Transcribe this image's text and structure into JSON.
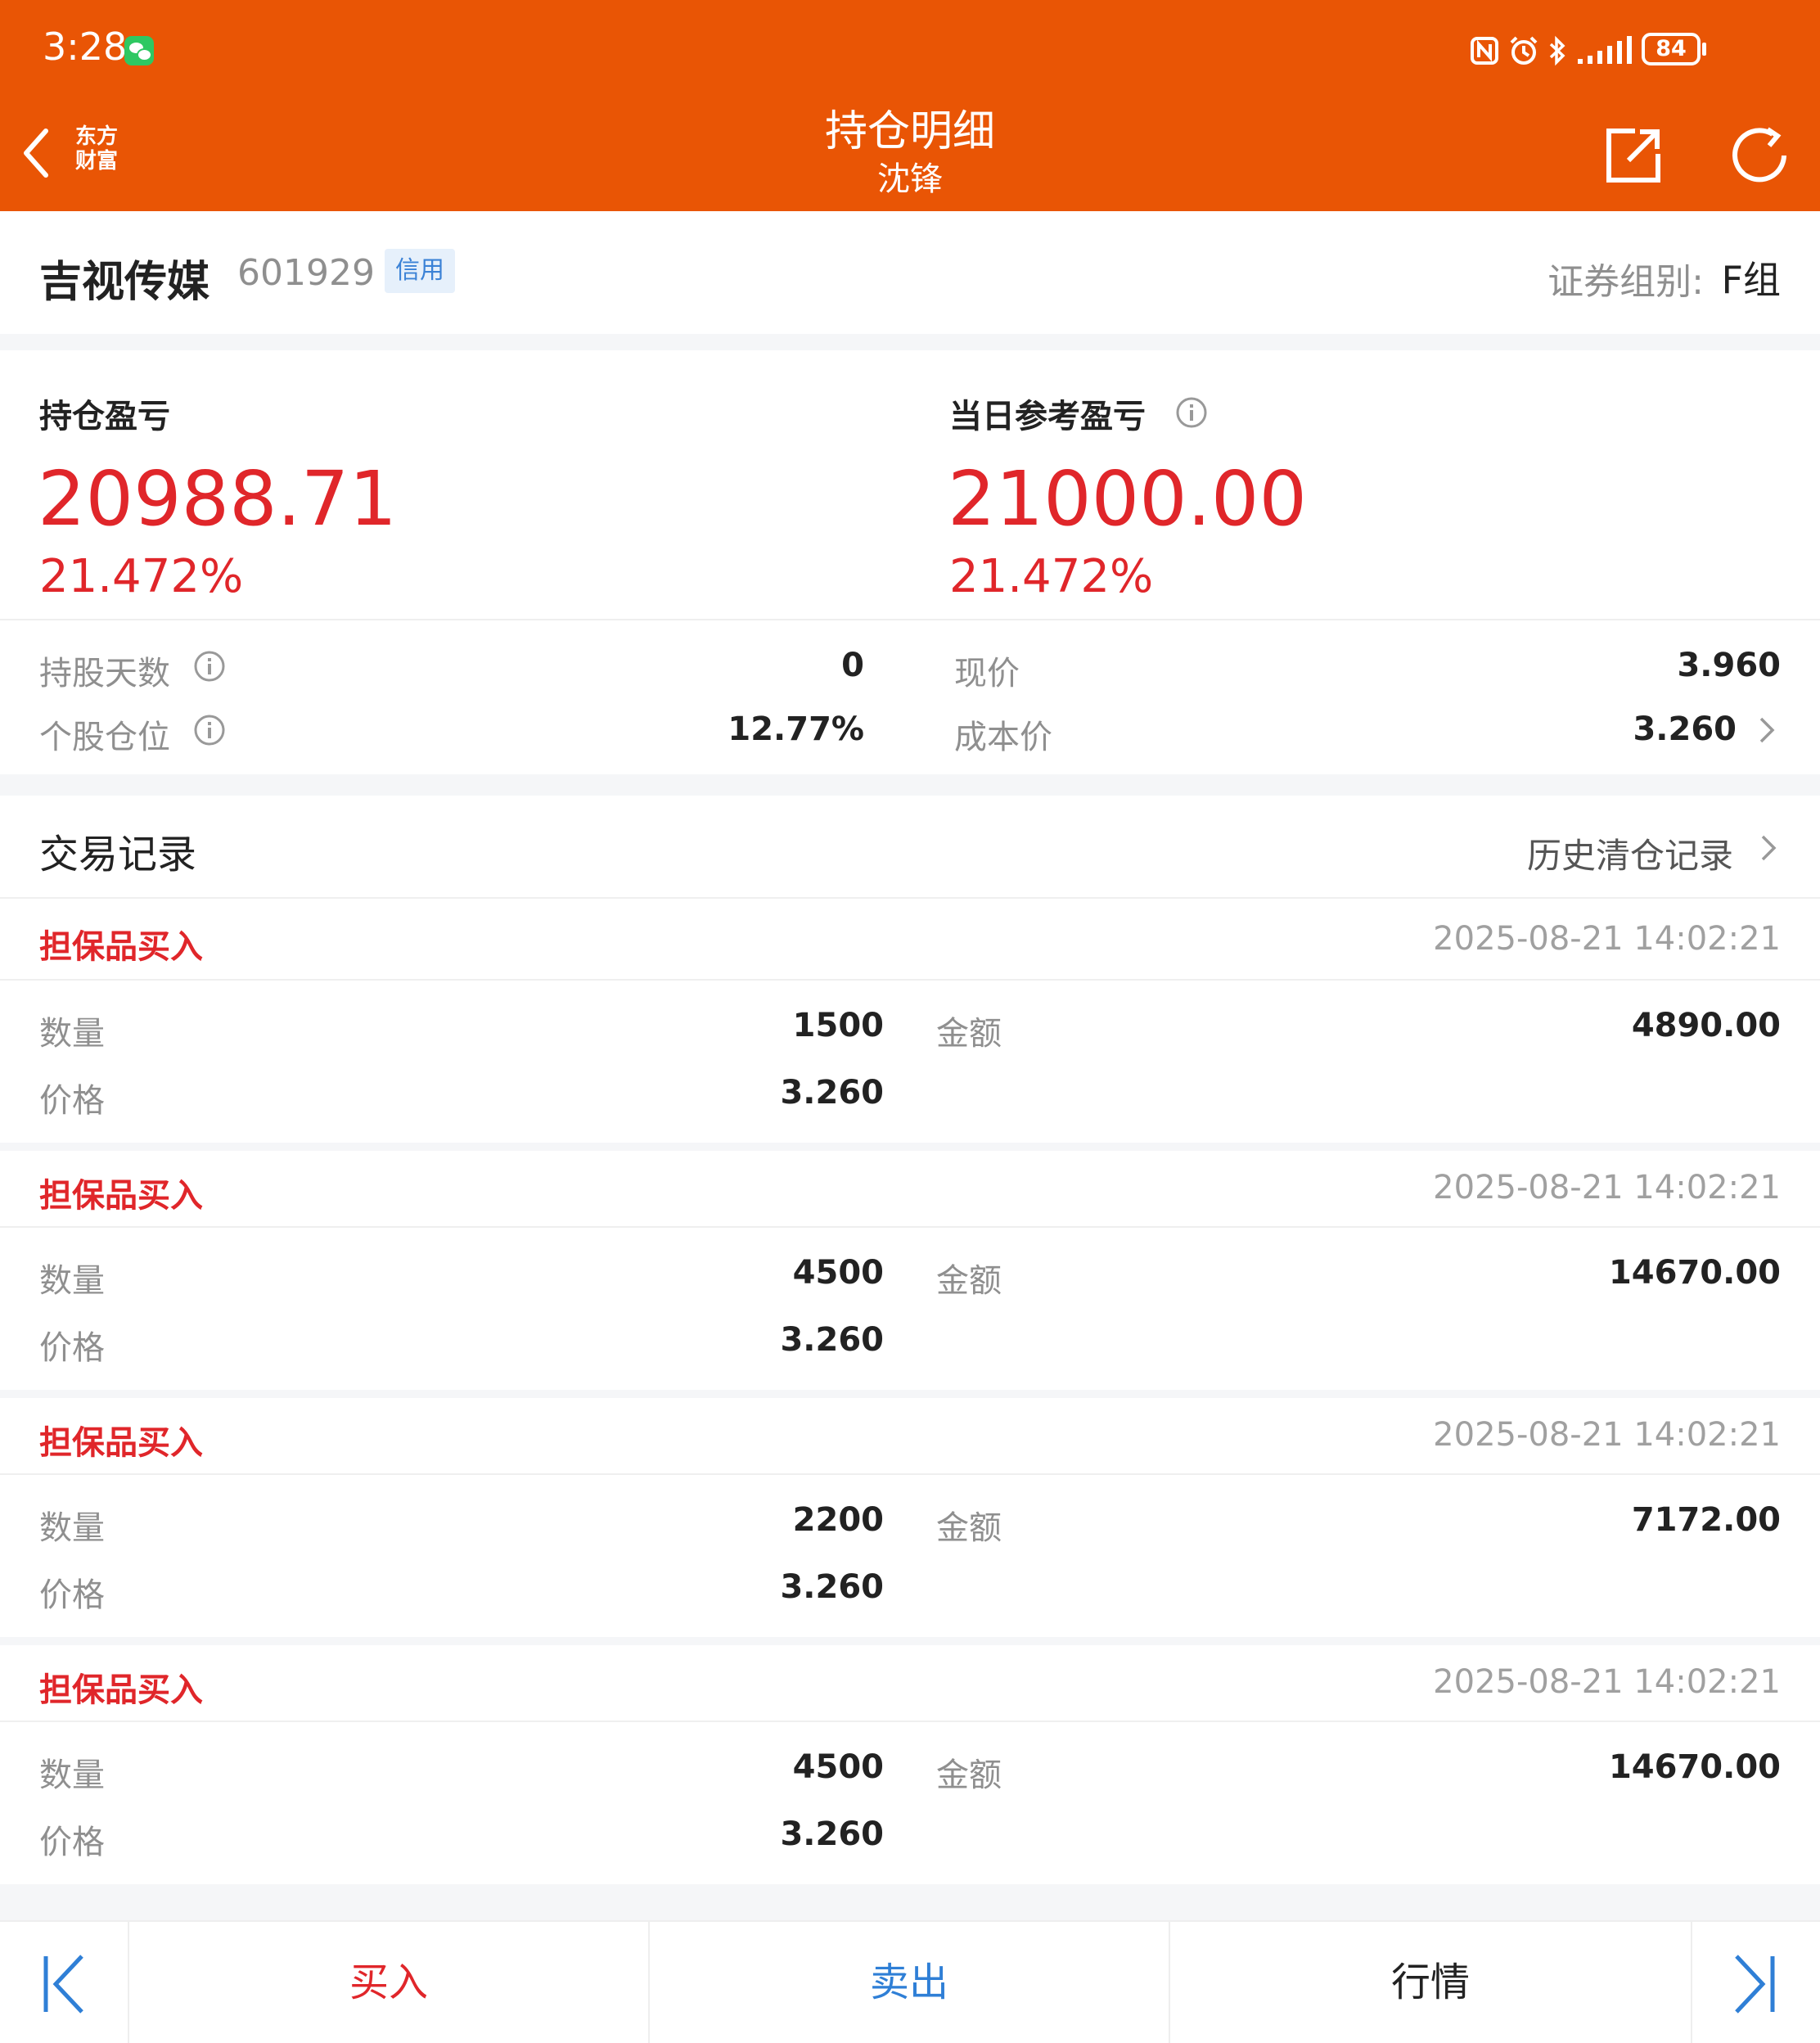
{
  "status_bar": {
    "time": "3:28",
    "battery": "84"
  },
  "nav": {
    "title": "持仓明细",
    "subtitle": "沈锋",
    "logo_line1": "东方",
    "logo_line2": "财富"
  },
  "stock": {
    "name": "吉视传媒",
    "code": "601929",
    "badge": "信用",
    "group_label": "证券组别:",
    "group_value": "F组"
  },
  "pnl": {
    "hold_label": "持仓盈亏",
    "hold_value": "20988.71",
    "hold_pct": "21.472%",
    "day_label": "当日参考盈亏",
    "day_value": "21000.00",
    "day_pct": "21.472%"
  },
  "metrics": {
    "days_label": "持股天数",
    "days_value": "0",
    "position_label": "个股仓位",
    "position_value": "12.77%",
    "price_label": "现价",
    "price_value": "3.960",
    "cost_label": "成本价",
    "cost_value": "3.260"
  },
  "trades": {
    "title": "交易记录",
    "history_link": "历史清仓记录",
    "qty_label": "数量",
    "price_label": "价格",
    "amount_label": "金额",
    "records": [
      {
        "type": "担保品买入",
        "time": "2025-08-21 14:02:21",
        "qty": "1500",
        "price": "3.260",
        "amount": "4890.00"
      },
      {
        "type": "担保品买入",
        "time": "2025-08-21 14:02:21",
        "qty": "4500",
        "price": "3.260",
        "amount": "14670.00"
      },
      {
        "type": "担保品买入",
        "time": "2025-08-21 14:02:21",
        "qty": "2200",
        "price": "3.260",
        "amount": "7172.00"
      },
      {
        "type": "担保品买入",
        "time": "2025-08-21 14:02:21",
        "qty": "4500",
        "price": "3.260",
        "amount": "14670.00"
      }
    ]
  },
  "bottom_bar": {
    "buy": "买入",
    "sell": "卖出",
    "quote": "行情"
  },
  "colors": {
    "brand": "#e95505",
    "gain": "#e0262a",
    "sell": "#2f7fd6"
  }
}
